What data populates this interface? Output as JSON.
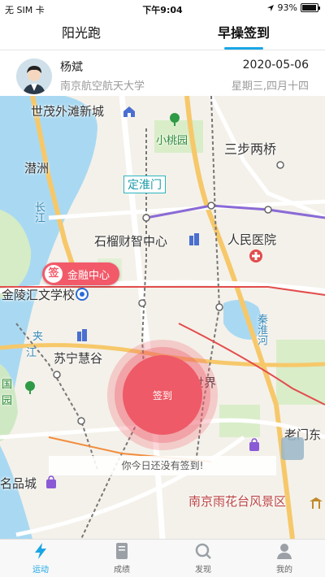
{
  "status_bar": {
    "carrier": "无 SIM 卡",
    "time": "下午9:04",
    "battery_text": "93%",
    "battery_level": 0.93
  },
  "tabs": [
    {
      "label": "阳光跑",
      "active": false
    },
    {
      "label": "早操签到",
      "active": true
    }
  ],
  "user": {
    "name": "杨斌",
    "school": "南京航空航天大学",
    "date": "2020-05-06",
    "weekday": "星期三,四月十四"
  },
  "map": {
    "labels": {
      "shimao": "世茂外滩新城",
      "xiaotaoyuan": "小桃园",
      "sanbuliangqiao": "三步两桥",
      "qianzhou": "潜洲",
      "changjiang": "长江",
      "dinghuaimen": "定淮门",
      "shiliu": "石榴财智中心",
      "renmin_hospital": "人民医院",
      "jinling": "金陵汇文学校",
      "jia": "夹",
      "jiang": "江",
      "qinhuai": "秦淮河",
      "suning": "苏宁慧谷",
      "shijie": "世界",
      "guo": "国",
      "yuan": "园",
      "mingpincheng": "名品城",
      "laomendong": "老门东",
      "yuhuatai": "南京雨花台风景区"
    },
    "poi": {
      "sig_char": "签",
      "name": "金融中心"
    },
    "checkin_label": "签到",
    "tip": "你今日还没有签到!"
  },
  "bottom_nav": [
    {
      "label": "运动",
      "icon": "lightning-icon",
      "active": true
    },
    {
      "label": "成绩",
      "icon": "scorebook-icon",
      "active": false
    },
    {
      "label": "发现",
      "icon": "discover-icon",
      "active": false
    },
    {
      "label": "我的",
      "icon": "profile-icon",
      "active": false
    }
  ],
  "colors": {
    "accent": "#1aa6e6",
    "checkin": "#ee5a67",
    "river": "#a9d9f2"
  }
}
